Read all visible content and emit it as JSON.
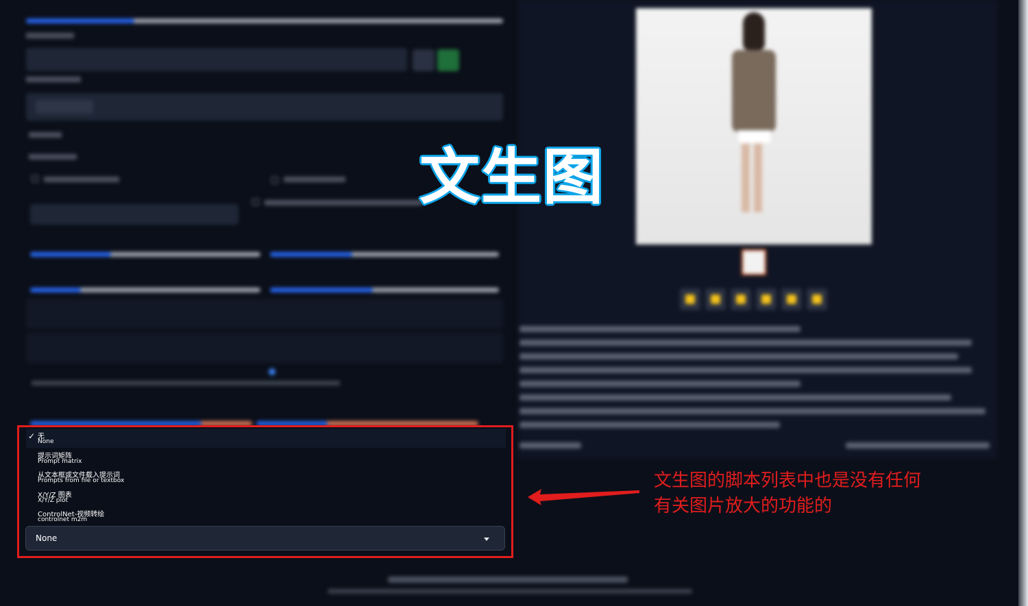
{
  "title_overlay": "文生图",
  "script_dropdown": {
    "options": [
      {
        "cn": "无",
        "en": "None",
        "selected": true
      },
      {
        "cn": "提示词矩阵",
        "en": "Prompt matrix",
        "selected": false
      },
      {
        "cn": "从文本框或文件载入提示词",
        "en": "Prompts from file or textbox",
        "selected": false
      },
      {
        "cn": "X/Y/Z 图表",
        "en": "X/Y/Z plot",
        "selected": false
      },
      {
        "cn": "ControlNet-视频转绘",
        "en": "controlnet m2m",
        "selected": false
      }
    ],
    "selected_value": "None",
    "check_glyph": "✓"
  },
  "annotation": {
    "line1": "文生图的脚本列表中也是没有任何",
    "line2": "有关图片放大的功能的"
  },
  "colors": {
    "highlight": "#e11d1d",
    "background": "#0b0f19",
    "title_outline": "#0ea5e9"
  },
  "icons": {
    "dropdown_caret": "chevron-down-icon",
    "annotation_arrow": "arrow-left-icon",
    "selected_check": "check-icon"
  }
}
